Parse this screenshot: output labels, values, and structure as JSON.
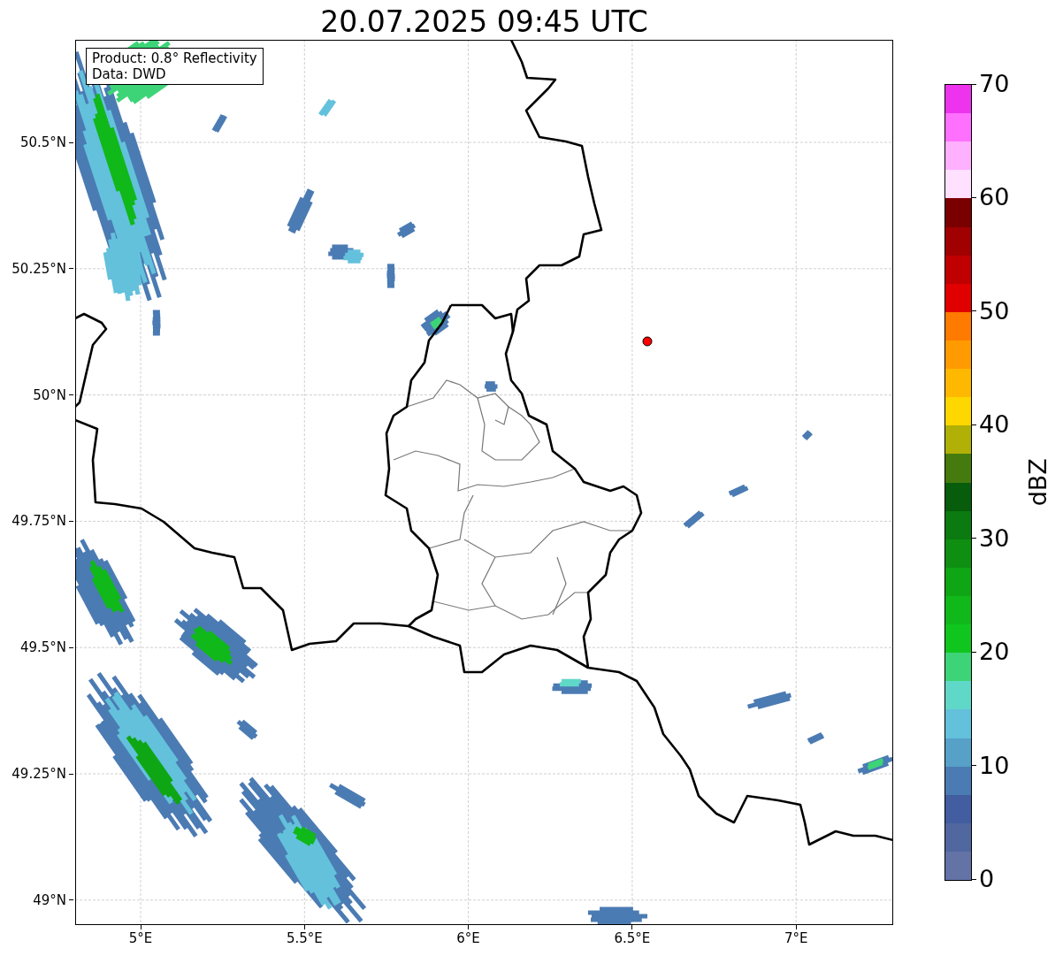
{
  "title": "20.07.2025 09:45 UTC",
  "info_box": {
    "lines": [
      "Product: 0.8° Reflectivity",
      "Data: DWD"
    ]
  },
  "lat_ticks": [
    "50.5°N",
    "50.25°N",
    "50°N",
    "49.75°N",
    "49.5°N",
    "49.25°N",
    "49°N"
  ],
  "lon_ticks": [
    "5°E",
    "5.5°E",
    "6°E",
    "6.5°E",
    "7°E"
  ],
  "colorbar": {
    "label": "dBZ",
    "ticks": [
      "70",
      "60",
      "50",
      "40",
      "30",
      "20",
      "10",
      "0"
    ],
    "bands": [
      {
        "color": "#ee33ee"
      },
      {
        "color": "#ff70ff"
      },
      {
        "color": "#ffb0ff"
      },
      {
        "color": "#ffe0ff"
      },
      {
        "color": "#7a0000"
      },
      {
        "color": "#a00000"
      },
      {
        "color": "#c00000"
      },
      {
        "color": "#e00000"
      },
      {
        "color": "#ff7a00"
      },
      {
        "color": "#ff9a00"
      },
      {
        "color": "#ffb800"
      },
      {
        "color": "#ffd700"
      },
      {
        "color": "#b0b006"
      },
      {
        "color": "#447a0e"
      },
      {
        "color": "#075d0c"
      },
      {
        "color": "#0b7a10"
      },
      {
        "color": "#0e8f12"
      },
      {
        "color": "#0fa615"
      },
      {
        "color": "#10b81a"
      },
      {
        "color": "#10c61e"
      },
      {
        "color": "#3dd477"
      },
      {
        "color": "#60d8c8"
      },
      {
        "color": "#63c1dc"
      },
      {
        "color": "#57a0c8"
      },
      {
        "color": "#4b7bb3"
      },
      {
        "color": "#425da0"
      },
      {
        "color": "#51679f"
      },
      {
        "color": "#6373a6"
      }
    ]
  }
}
